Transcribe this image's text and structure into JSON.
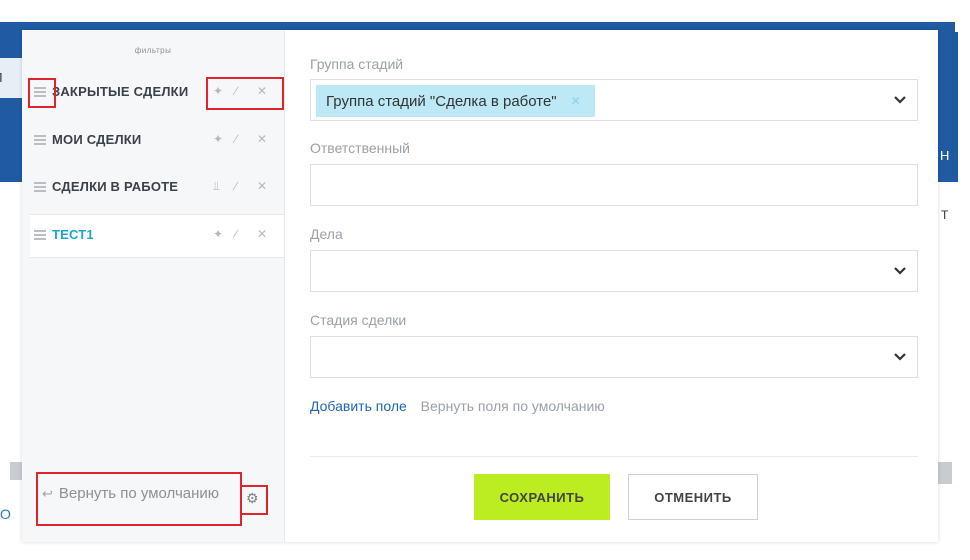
{
  "background": {
    "left_text": "Л",
    "left_bottom_text": "О",
    "right_text_1": "Н",
    "right_text_2": "Т"
  },
  "sidebar": {
    "title": "ФИЛЬТРЫ",
    "items": [
      {
        "label": "ЗАКРЫТЫЕ СДЕЛКИ",
        "active": false
      },
      {
        "label": "МОИ СДЕЛКИ",
        "active": false
      },
      {
        "label": "СДЕЛКИ В РАБОТЕ",
        "active": false
      },
      {
        "label": "ТЕСТ1",
        "active": true
      }
    ],
    "icons": {
      "pin": "pin-icon",
      "edit": "pencil-icon",
      "delete": "close-icon",
      "drag": "drag-handle-icon"
    },
    "reset_default": "Вернуть по умолчанию",
    "settings_icon": "gear-icon"
  },
  "form": {
    "fields": [
      {
        "label": "Группа стадий",
        "value_chip": "Группа стадий \"Сделка в работе\"",
        "has_dropdown": true
      },
      {
        "label": "Ответственный",
        "value": "",
        "has_dropdown": false
      },
      {
        "label": "Дела",
        "value": "",
        "has_dropdown": true
      },
      {
        "label": "Стадия сделки",
        "value": "",
        "has_dropdown": true
      }
    ],
    "add_field": "Добавить поле",
    "reset_fields": "Вернуть поля по умолчанию",
    "save": "СОХРАНИТЬ",
    "cancel": "ОТМЕНИТЬ"
  },
  "colors": {
    "accent_blue": "#1ba6cc",
    "save_green": "#bbed21",
    "chip_bg": "#bde9f7",
    "highlight_red": "#e0242d",
    "header_blue": "#1f5aa3"
  }
}
